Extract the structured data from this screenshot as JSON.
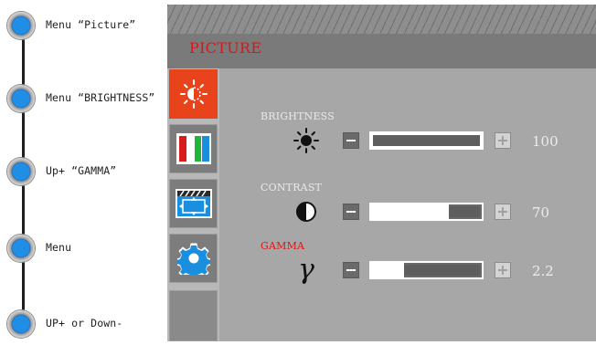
{
  "steps": [
    {
      "label": "Menu  “Picture”",
      "icon": "step-bullet"
    },
    {
      "label": "Menu  “BRIGHTNESS”",
      "icon": "step-bullet"
    },
    {
      "label": "Up+  “GAMMA”",
      "icon": "step-bullet"
    },
    {
      "label": "Menu",
      "icon": "step-bullet"
    },
    {
      "label": "UP+ or Down-",
      "icon": "step-bullet"
    }
  ],
  "osd": {
    "title": "PICTURE",
    "tabs": [
      {
        "icon": "brightness-tab-icon",
        "state": "active"
      },
      {
        "icon": "color-bars-icon",
        "state": "inactive"
      },
      {
        "icon": "image-adjust-icon",
        "state": "inactive"
      },
      {
        "icon": "gear-icon",
        "state": "inactive"
      },
      {
        "icon": "blank",
        "state": "blank"
      }
    ],
    "settings": [
      {
        "name": "BRIGHTNESS",
        "icon": "sun-icon",
        "value": "100",
        "level": 1.0,
        "highlight": false
      },
      {
        "name": "CONTRAST",
        "icon": "contrast-icon",
        "value": "70",
        "level": 0.7,
        "highlight": false
      },
      {
        "name": "GAMMA",
        "icon": "gamma-icon",
        "symbol": "γ",
        "value": "2.2",
        "level": 0.3,
        "highlight": true
      }
    ]
  },
  "colors": {
    "accent": "#e8431a",
    "highlight_text": "#e01414",
    "bullet": "#1f8fe6"
  }
}
